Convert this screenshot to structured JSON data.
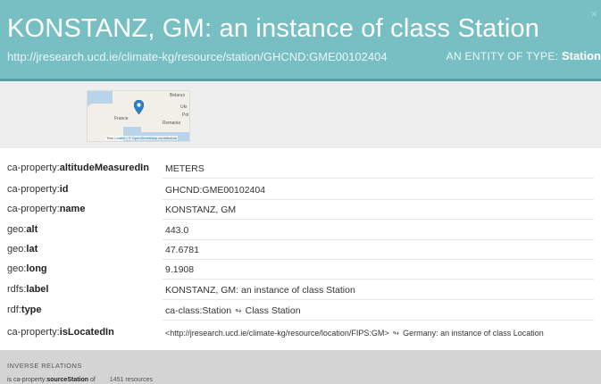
{
  "header": {
    "title": "KONSTANZ, GM: an instance of class Station",
    "uri": "http://jresearch.ucd.ie/climate-kg/resource/station/GHCND:GME00102404",
    "entity_type_prefix": "AN ENTITY OF TYPE:",
    "entity_type": "Station",
    "close_icon": "close-icon",
    "close_glyph": "×"
  },
  "map": {
    "labels": [
      "Belarus",
      "France",
      "Romania",
      "Pol",
      "Ukr"
    ],
    "attribution_prefix": "Tiles",
    "attribution_leaflet": "Leaflet",
    "attribution_sep": " | © ",
    "attribution_osm": "OpenStreetMap",
    "attribution_suffix": " contributors",
    "marker_icon": "map-marker-icon"
  },
  "properties": [
    {
      "prefix": "ca-property:",
      "name": "altitudeMeasuredIn",
      "value": "METERS"
    },
    {
      "prefix": "ca-property:",
      "name": "id",
      "value": "GHCND:GME00102404"
    },
    {
      "prefix": "ca-property:",
      "name": "name",
      "value": "KONSTANZ, GM"
    },
    {
      "prefix": "geo:",
      "name": "alt",
      "value": "443.0"
    },
    {
      "prefix": "geo:",
      "name": "lat",
      "value": "47.6781"
    },
    {
      "prefix": "geo:",
      "name": "long",
      "value": "9.1908"
    },
    {
      "prefix": "rdfs:",
      "name": "label",
      "value": "KONSTANZ, GM: an instance of class Station"
    },
    {
      "prefix": "rdf:",
      "name": "type",
      "value": "ca-class:Station",
      "link_label": "Class Station"
    },
    {
      "prefix": "ca-property:",
      "name": "isLocatedIn",
      "value": "<http://jresearch.ucd.ie/climate-kg/resource/location/FIPS:GM>",
      "link_label": "Germany: an instance of class Location"
    }
  ],
  "link_arrow": "↬",
  "inverse": {
    "heading": "INVERSE RELATIONS",
    "relation_prefix": "is ca-property:",
    "relation_name": "sourceStation",
    "relation_suffix": " of",
    "count": "1451 resources"
  }
}
